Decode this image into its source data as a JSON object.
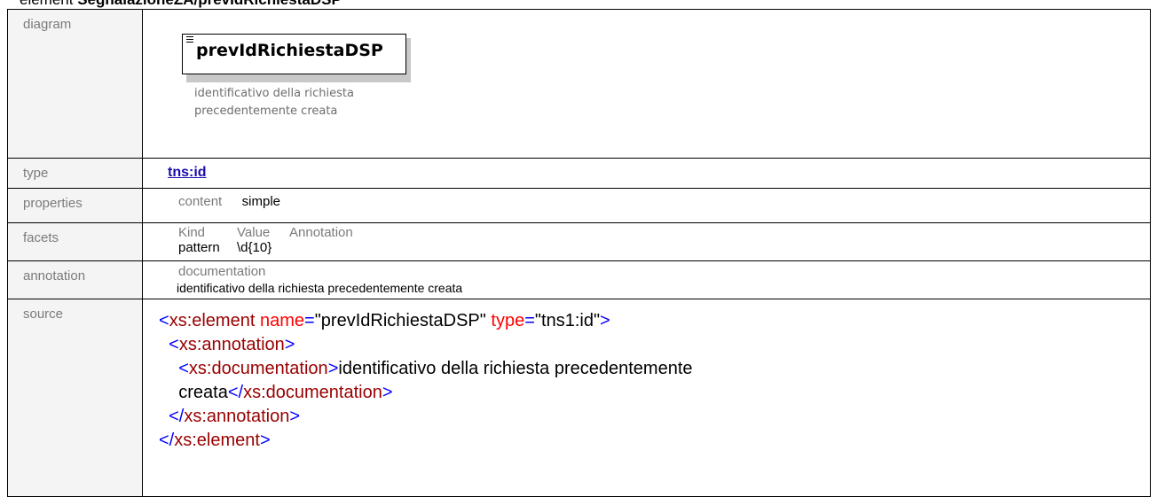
{
  "heading": {
    "prefix": "element ",
    "name": "SegnalazioneZA/prevIdRichiestaDSP"
  },
  "rows": {
    "diagram": {
      "label": "diagram",
      "element_name": "prevIdRichiestaDSP",
      "doc_line1": "identificativo della richiesta",
      "doc_line2": "precedentemente creata"
    },
    "type": {
      "label": "type",
      "value": "tns:id"
    },
    "properties": {
      "label": "properties",
      "col1": "content",
      "val1": "simple"
    },
    "facets": {
      "label": "facets",
      "headers": [
        "Kind",
        "Value",
        "Annotation"
      ],
      "row": {
        "kind": "pattern",
        "value": "\\d{10}",
        "annotation": ""
      }
    },
    "annotation": {
      "label": "annotation",
      "heading": "documentation",
      "text": "identificativo della richiesta precedentemente creata"
    },
    "source": {
      "label": "source",
      "tag_element": "xs:element",
      "attr_name": "name",
      "val_name": "\"prevIdRichiestaDSP\"",
      "attr_type": "type",
      "val_type": "\"tns1:id\"",
      "tag_annotation": "xs:annotation",
      "tag_documentation": "xs:documentation",
      "doc_text1": "identificativo della richiesta precedentemente",
      "doc_text2": "creata"
    }
  }
}
